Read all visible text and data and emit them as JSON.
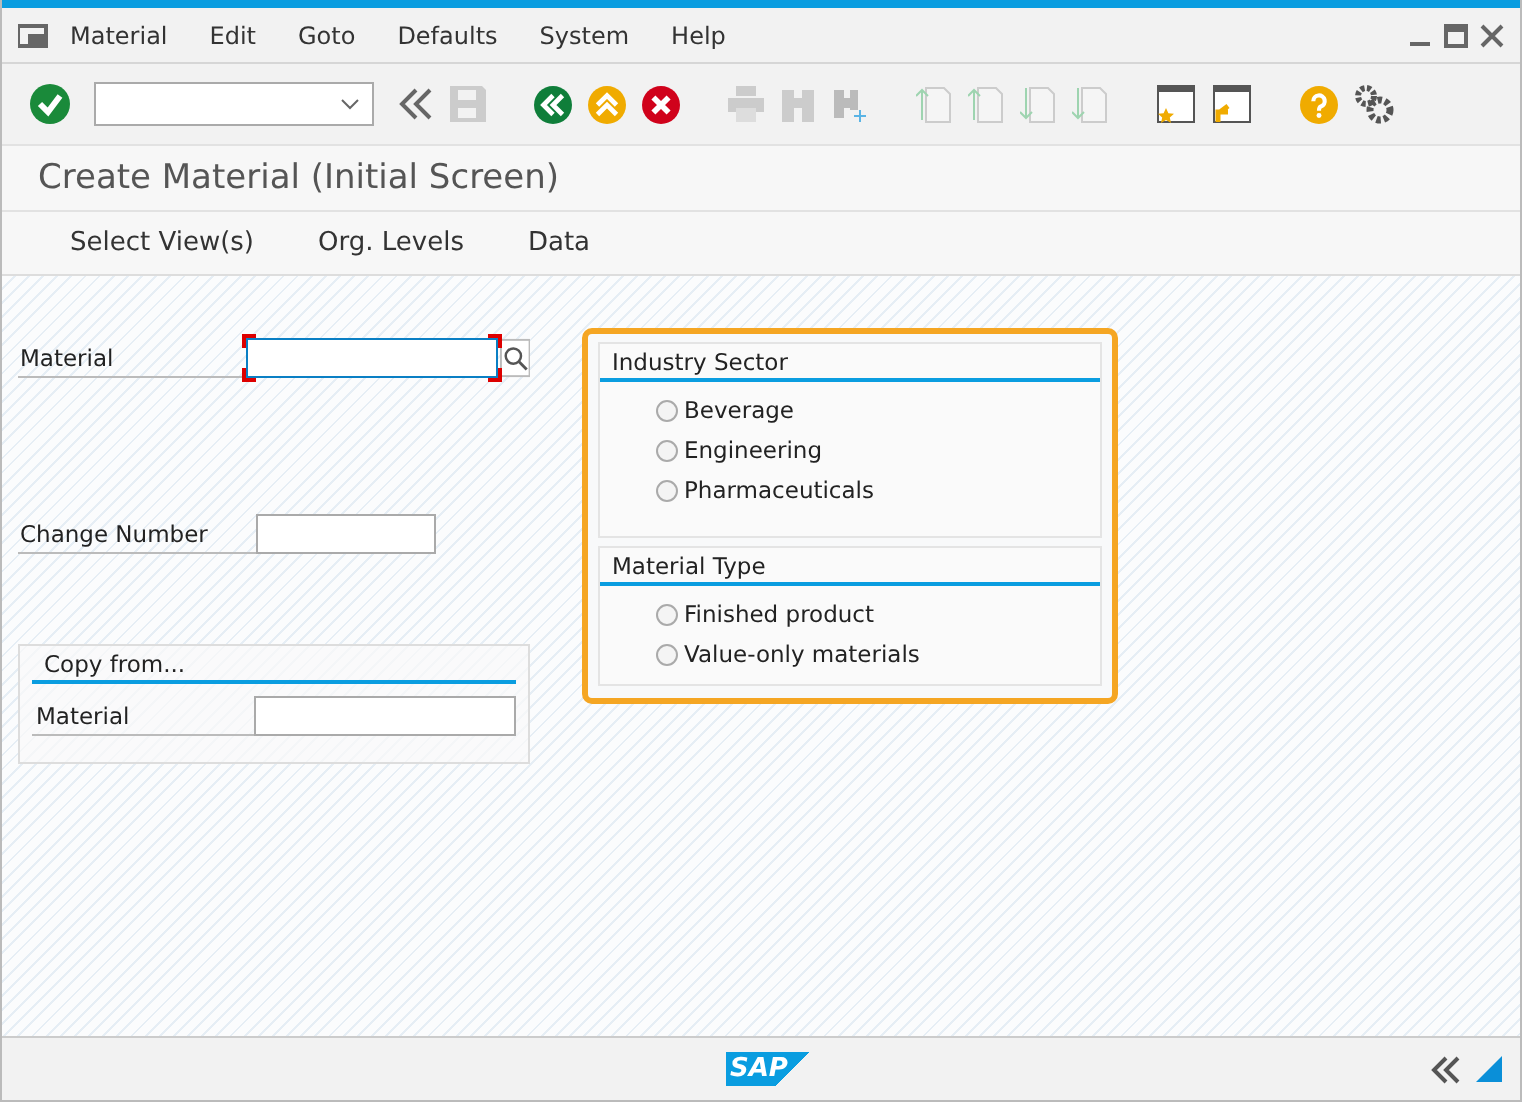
{
  "menu": [
    "Material",
    "Edit",
    "Goto",
    "Defaults",
    "System",
    "Help"
  ],
  "title": "Create Material (Initial Screen)",
  "app_toolbar": [
    "Select View(s)",
    "Org. Levels",
    "Data"
  ],
  "fields": [
    {
      "label": "Material",
      "kind": "required"
    },
    {
      "label": "Change Number",
      "kind": "plain"
    }
  ],
  "copy_from": {
    "title": "Copy from...",
    "fields": [
      {
        "label": "Material"
      }
    ]
  },
  "groups": [
    {
      "title": "Industry Sector",
      "options": [
        {
          "label": "Beverage",
          "selected": false
        },
        {
          "label": "Engineering",
          "selected": false
        },
        {
          "label": "Pharmaceuticals",
          "selected": false
        }
      ]
    },
    {
      "title": "Material Type",
      "options": [
        {
          "label": "Finished product",
          "selected": false
        },
        {
          "label": "Value-only materials",
          "selected": false
        }
      ]
    }
  ],
  "status_bar": {
    "logo": "SAP"
  }
}
